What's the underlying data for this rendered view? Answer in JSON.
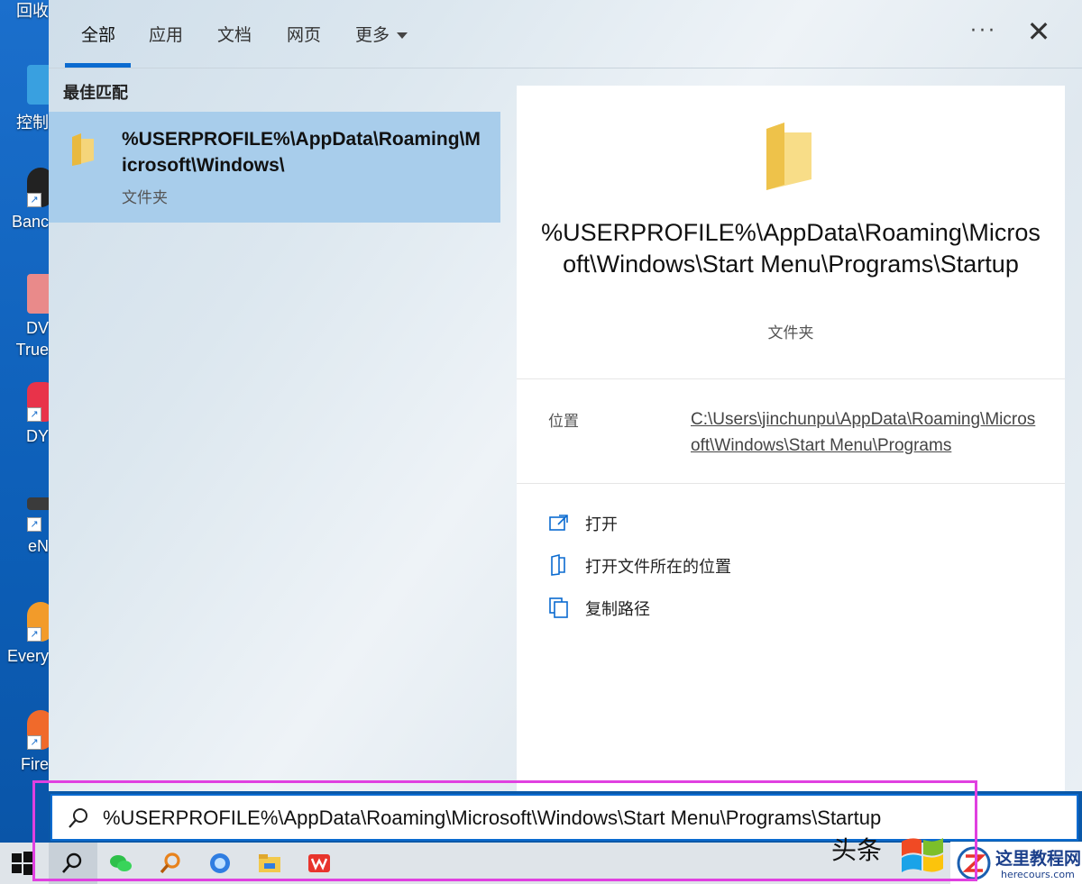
{
  "desktop": {
    "icons": [
      {
        "label": "回收",
        "color": "#2d8ad6"
      },
      {
        "label": "控制",
        "color": "#39a0e0"
      },
      {
        "label": "Banc",
        "color": "#222222"
      },
      {
        "label": "DV",
        "color": "#e98a8a"
      },
      {
        "label": "True",
        "color": "#e98a8a"
      },
      {
        "label": "DY",
        "color": "#e8334a"
      },
      {
        "label": "eN",
        "color": "#3b3b3b"
      },
      {
        "label": "Every",
        "color": "#f29b2a"
      },
      {
        "label": "Fire",
        "color": "#f06a2b"
      }
    ]
  },
  "tabs": {
    "all": "全部",
    "apps": "应用",
    "docs": "文档",
    "web": "网页",
    "more": "更多",
    "dots": "···",
    "close": "✕"
  },
  "best_match": {
    "section_label": "最佳匹配",
    "title": "%USERPROFILE%\\AppData\\Roaming\\Microsoft\\Windows\\",
    "type": "文件夹"
  },
  "preview": {
    "title": "%USERPROFILE%\\AppData\\Roaming\\Microsoft\\Windows\\Start Menu\\Programs\\Startup",
    "type": "文件夹",
    "location_label": "位置",
    "location_value": "C:\\Users\\jinchunpu\\AppData\\Roaming\\Microsoft\\Windows\\Start Menu\\Programs",
    "actions": [
      {
        "label": "打开",
        "icon": "open-icon"
      },
      {
        "label": "打开文件所在的位置",
        "icon": "open-location-icon"
      },
      {
        "label": "复制路径",
        "icon": "copy-path-icon"
      }
    ]
  },
  "search": {
    "query": "%USERPROFILE%\\AppData\\Roaming\\Microsoft\\Windows\\Start Menu\\Programs\\Startup"
  },
  "watermark": {
    "text": "头条",
    "text2": "@",
    "site": "这里教程网",
    "site_url": "herecours.com"
  },
  "colors": {
    "accent": "#0b6bd0",
    "selected": "#a8cdeb",
    "highlight": "#e040e0"
  }
}
